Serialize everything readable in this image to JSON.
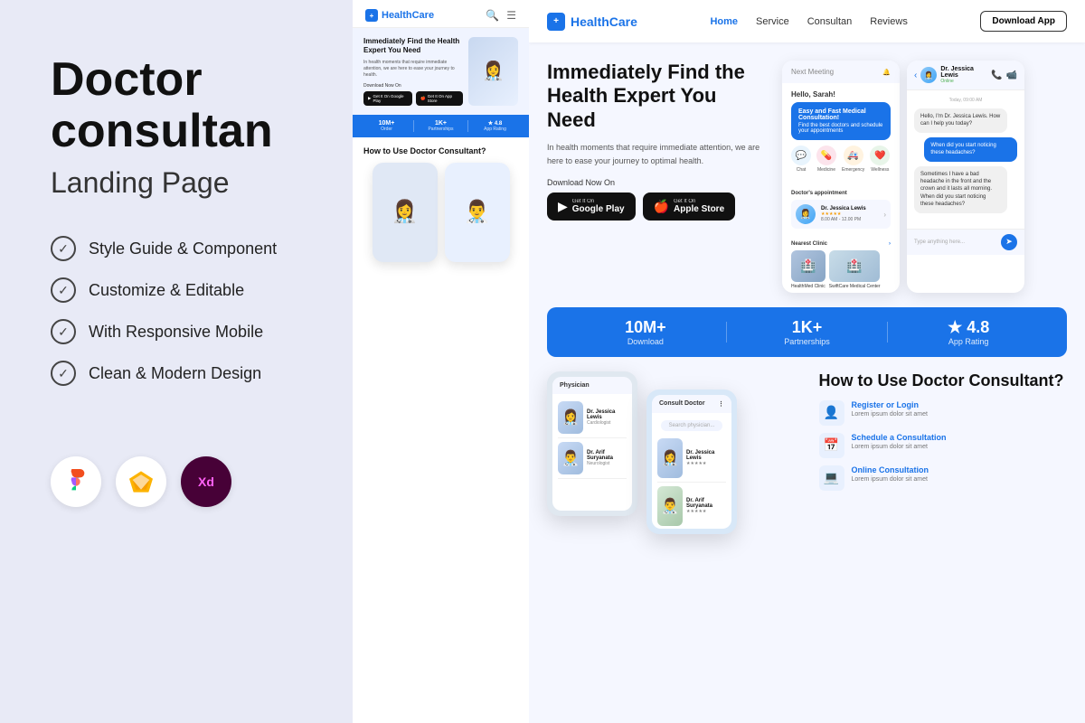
{
  "left": {
    "title_line1": "Doctor",
    "title_line2": "consultan",
    "subtitle": "Landing Page",
    "features": [
      {
        "id": "feat1",
        "text": "Style Guide & Component"
      },
      {
        "id": "feat2",
        "text": "Customize & Editable"
      },
      {
        "id": "feat3",
        "text": "With Responsive Mobile"
      },
      {
        "id": "feat4",
        "text": "Clean & Modern Design"
      }
    ],
    "tools": [
      {
        "id": "figma",
        "label": "Figma",
        "symbol": "✦"
      },
      {
        "id": "sketch",
        "label": "Sketch",
        "symbol": "◆"
      },
      {
        "id": "xd",
        "label": "XD",
        "symbol": "Xd"
      }
    ]
  },
  "mobile_preview": {
    "brand": "HealthCare",
    "hero_title": "Immediately Find the Health Expert You Need",
    "hero_desc": "In health moments that require immediate attention, we are here to ease your journey to health.",
    "download_label": "Download Now On",
    "btn_google": "Get It On Google Play",
    "btn_apple": "Get It On App Store",
    "stats": [
      {
        "value": "10M+",
        "label": "Order"
      },
      {
        "value": "1K+",
        "label": "Partnerships"
      },
      {
        "value": "4.8",
        "label": "App Rating"
      }
    ],
    "section2_title": "How to Use Doctor Consultant?"
  },
  "website_preview": {
    "brand": "HealthCare",
    "nav_items": [
      "Home",
      "Service",
      "Consultan",
      "Reviews"
    ],
    "nav_active": "Home",
    "download_btn": "Download App",
    "hero_title": "Immediately Find the Health Expert You Need",
    "hero_desc": "In health moments that require immediate attention, we are here to ease your journey to optimal health.",
    "download_label": "Download Now On",
    "btn_google": "Get It On\nGoogle Play",
    "btn_apple": "Get It On\nApple Store",
    "stats": [
      {
        "value": "10M+",
        "label": "Download"
      },
      {
        "value": "1K+",
        "label": "Partnerships"
      },
      {
        "value": "★ 4.8",
        "label": "App Rating"
      }
    ],
    "how_to_title": "How to Use Doctor Consultant?",
    "steps": [
      {
        "icon": "👤",
        "title": "Register or Login",
        "desc": "Lorem ipsum dolor sit amet"
      },
      {
        "icon": "📅",
        "title": "Schedule a Consultation",
        "desc": "Lorem ipsum dolor sit amet"
      },
      {
        "icon": "💻",
        "title": "Online Consultation",
        "desc": "Lorem ipsum dolor sit amet"
      }
    ],
    "doctor": {
      "name": "Dr. Jessica Lewis",
      "rating": "★★★★★",
      "time": "8.00 AM - 12.00 PM"
    },
    "chat": {
      "doctor_name": "Dr. Jessica Lewis",
      "status": "Online",
      "greeting": "Hello, I'm Dr. Jessica Lewis. How can I help you today?",
      "question": "When did you start noticing these headaches?",
      "answer": "Sometimes I have a bad headache in the front and the crown and it lasts all morning. When did you start noticing these headaches?"
    },
    "clinics": [
      {
        "name": "HealthMed Clinic"
      },
      {
        "name": "SwiftCare Medical Center"
      }
    ]
  }
}
